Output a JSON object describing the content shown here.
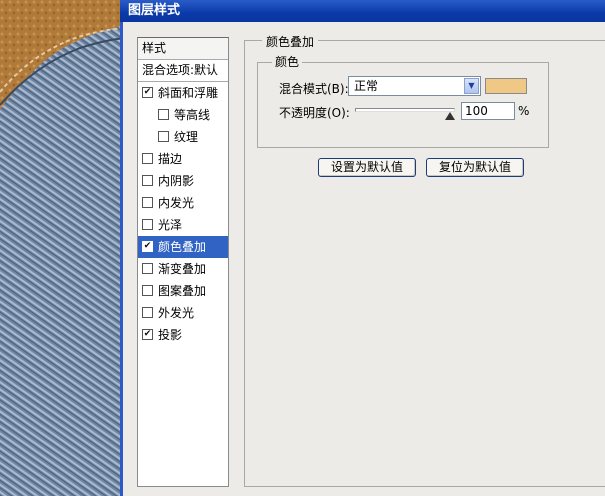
{
  "dialog": {
    "title": "图层样式"
  },
  "styles_list": {
    "header": "样式",
    "blending_options": "混合选项:默认",
    "items": [
      {
        "label": "斜面和浮雕",
        "checked": true,
        "sub": false,
        "selected": false
      },
      {
        "label": "等高线",
        "checked": false,
        "sub": true,
        "selected": false
      },
      {
        "label": "纹理",
        "checked": false,
        "sub": true,
        "selected": false
      },
      {
        "label": "描边",
        "checked": false,
        "sub": false,
        "selected": false
      },
      {
        "label": "内阴影",
        "checked": false,
        "sub": false,
        "selected": false
      },
      {
        "label": "内发光",
        "checked": false,
        "sub": false,
        "selected": false
      },
      {
        "label": "光泽",
        "checked": false,
        "sub": false,
        "selected": false
      },
      {
        "label": "颜色叠加",
        "checked": true,
        "sub": false,
        "selected": true
      },
      {
        "label": "渐变叠加",
        "checked": false,
        "sub": false,
        "selected": false
      },
      {
        "label": "图案叠加",
        "checked": false,
        "sub": false,
        "selected": false
      },
      {
        "label": "外发光",
        "checked": false,
        "sub": false,
        "selected": false
      },
      {
        "label": "投影",
        "checked": true,
        "sub": false,
        "selected": false
      }
    ]
  },
  "panel": {
    "title": "颜色叠加",
    "group_title": "颜色",
    "blend_mode_label": "混合模式(B):",
    "blend_mode_value": "正常",
    "overlay_color": "#efc886",
    "opacity_label": "不透明度(O):",
    "opacity_value": "100",
    "opacity_unit": "%",
    "opacity_fraction": 1.0,
    "btn_set_default": "设置为默认值",
    "btn_reset_default": "复位为默认值"
  }
}
